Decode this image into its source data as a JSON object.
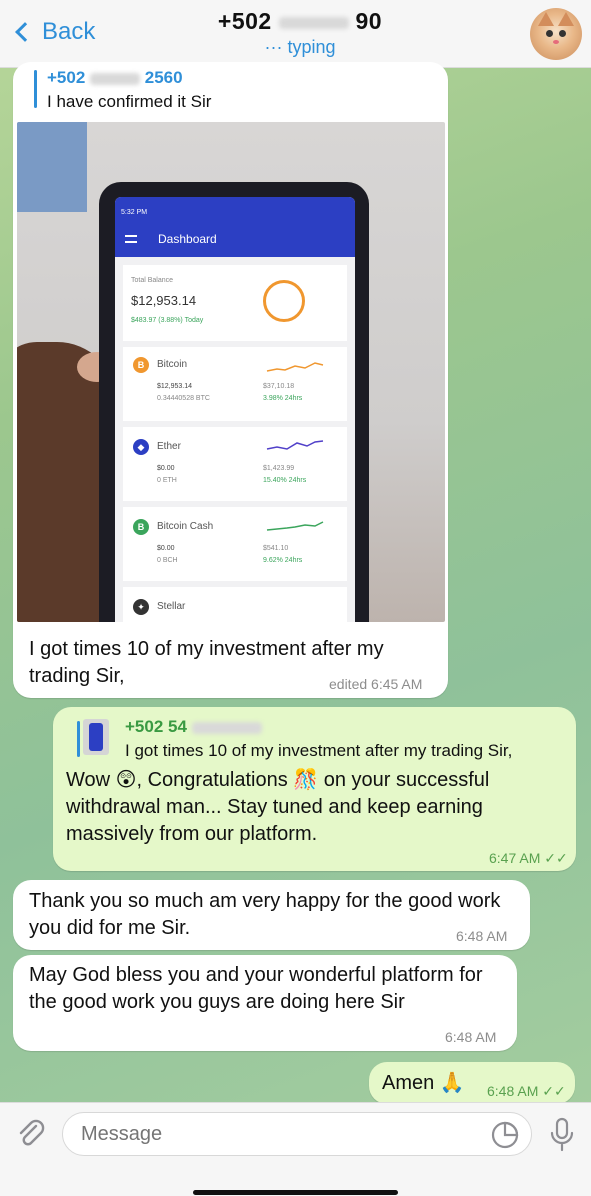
{
  "header": {
    "back_label": "Back",
    "title": "+502",
    "title_suffix": "90",
    "status": "typing"
  },
  "messages": [
    {
      "reply_name": "+502",
      "reply_suffix": "2560",
      "reply_text": "I have confirmed it Sir",
      "text": "I got times 10 of my investment after my trading Sir,",
      "time": "edited 6:45 AM"
    },
    {
      "reply_name": "+502 54",
      "reply_text": "I got times 10 of my investment after my trading Sir,",
      "text": "Wow 😲, Congratulations 🎊 on your successful withdrawal man... Stay tuned and keep earning massively from our platform.",
      "time": "6:47 AM"
    },
    {
      "text": "Thank you so much am very happy for the good work you did for me Sir.",
      "time": "6:48 AM"
    },
    {
      "text": "May God bless you and your wonderful platform for the good work you guys are doing here Sir",
      "time": "6:48 AM"
    },
    {
      "text": "Amen 🙏",
      "time": "6:48 AM"
    }
  ],
  "photo": {
    "status_time": "5:32 PM",
    "app_title": "Dashboard",
    "total_label": "Total Balance",
    "total_value": "$12,953.14",
    "total_change": "$483.97 (3.88%) Today",
    "assets": [
      {
        "name": "Bitcoin",
        "amount": "$12,953.14",
        "units": "0.34440528 BTC",
        "price": "$37,10.18",
        "change": "3.98% 24hrs",
        "color": "#f0972f",
        "symbol": "B"
      },
      {
        "name": "Ether",
        "amount": "$0.00",
        "units": "0 ETH",
        "price": "$1,423.99",
        "change": "15.40% 24hrs",
        "color": "#2c3fc3",
        "symbol": "◆"
      },
      {
        "name": "Bitcoin Cash",
        "amount": "$0.00",
        "units": "0 BCH",
        "price": "$541.10",
        "change": "9.62% 24hrs",
        "color": "#3ba55c",
        "symbol": "B"
      },
      {
        "name": "Stellar"
      }
    ]
  },
  "input": {
    "placeholder": "Message"
  },
  "colors": {
    "accent": "#2f8fd8",
    "outgoing_bubble": "#e5f8c9",
    "incoming_bubble": "#ffffff"
  }
}
